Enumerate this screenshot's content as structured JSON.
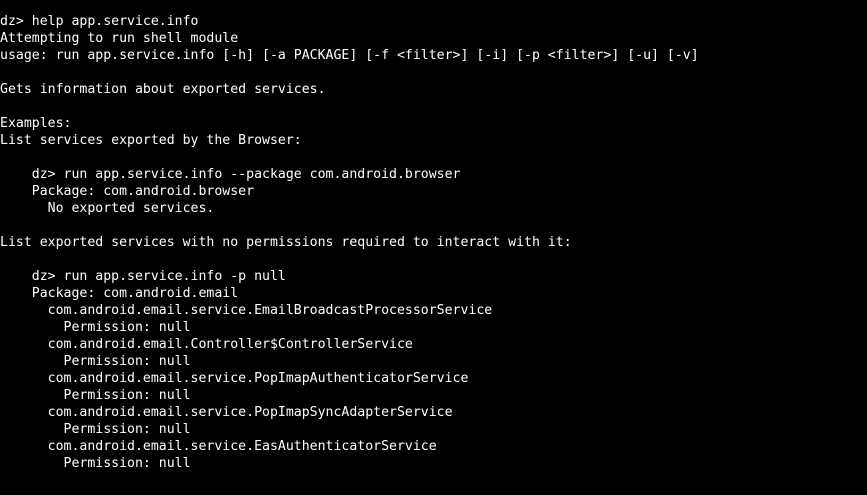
{
  "terminal": {
    "background": "#000000",
    "foreground": "#ffffff",
    "lines": [
      "dz> help app.service.info",
      "Attempting to run shell module",
      "usage: run app.service.info [-h] [-a PACKAGE] [-f <filter>] [-i] [-p <filter>] [-u] [-v]",
      "",
      "Gets information about exported services.",
      "",
      "Examples:",
      "List services exported by the Browser:",
      "",
      "    dz> run app.service.info --package com.android.browser",
      "    Package: com.android.browser",
      "      No exported services.",
      "",
      "List exported services with no permissions required to interact with it:",
      "",
      "    dz> run app.service.info -p null",
      "    Package: com.android.email",
      "      com.android.email.service.EmailBroadcastProcessorService",
      "        Permission: null",
      "      com.android.email.Controller$ControllerService",
      "        Permission: null",
      "      com.android.email.service.PopImapAuthenticatorService",
      "        Permission: null",
      "      com.android.email.service.PopImapSyncAdapterService",
      "        Permission: null",
      "      com.android.email.service.EasAuthenticatorService",
      "        Permission: null"
    ]
  }
}
